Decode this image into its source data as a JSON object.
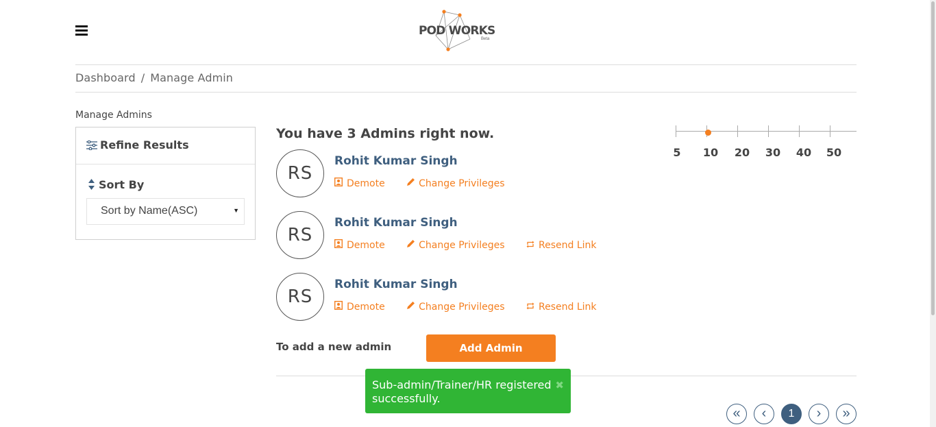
{
  "header": {
    "logo_text": "POD WORKS",
    "logo_badge": "Beta",
    "menu_icon": "hamburger-menu-icon"
  },
  "breadcrumb": {
    "items": [
      "Dashboard",
      "Manage Admin"
    ],
    "separator": "/"
  },
  "sidebar": {
    "title": "Manage Admins",
    "refine_label": "Refine Results",
    "refine_icon": "sliders-icon",
    "sort_label": "Sort By",
    "sort_icon": "sort-icon",
    "sort_value": "Sort by Name(ASC)"
  },
  "main": {
    "heading": "You have 3 Admins right now.",
    "admins": [
      {
        "initials": "RS",
        "name": "Rohit Kumar Singh",
        "actions": {
          "demote": "Demote",
          "change": "Change Privileges"
        }
      },
      {
        "initials": "RS",
        "name": "Rohit Kumar Singh",
        "actions": {
          "demote": "Demote",
          "change": "Change Privileges",
          "resend": "Resend Link"
        }
      },
      {
        "initials": "RS",
        "name": "Rohit Kumar Singh",
        "actions": {
          "demote": "Demote",
          "change": "Change Privileges",
          "resend": "Resend Link"
        }
      }
    ],
    "add_label": "To add a new admin",
    "add_button": "Add Admin"
  },
  "page_size": {
    "options": [
      "5",
      "10",
      "20",
      "30",
      "40",
      "50"
    ],
    "selected": "10"
  },
  "toast": {
    "message": "Sub-admin/Trainer/HR registered successfully.",
    "close_icon": "close-icon"
  },
  "pagination": {
    "first": "«",
    "prev": "‹",
    "current": "1",
    "next": "›",
    "last": "»"
  },
  "colors": {
    "accent": "#f47f20",
    "primary": "#3f5f7f",
    "success": "#30b535"
  }
}
